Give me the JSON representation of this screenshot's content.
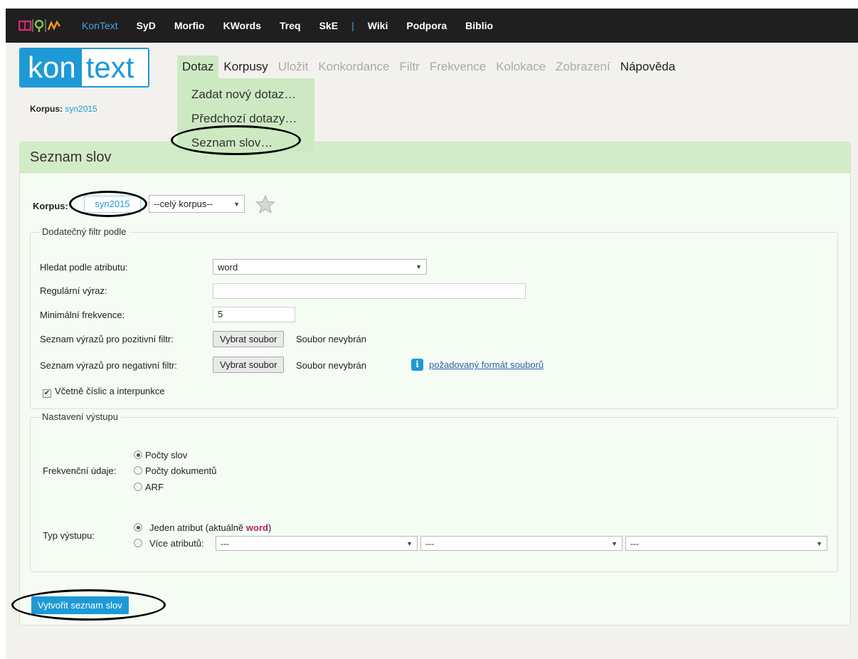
{
  "topnav": {
    "items": [
      "KonText",
      "SyD",
      "Morfio",
      "KWords",
      "Treq",
      "SkE",
      "|",
      "Wiki",
      "Podpora",
      "Biblio"
    ],
    "brand_colors": [
      "#d4286a",
      "#8bc34a",
      "#f7941d"
    ]
  },
  "brand": {
    "kon": "kon",
    "text": "text"
  },
  "corpus_line": {
    "label": "Korpus:",
    "value": "syn2015"
  },
  "mainmenu": {
    "items": [
      "Dotaz",
      "Korpusy",
      "Uložit",
      "Konkordance",
      "Filtr",
      "Frekvence",
      "Kolokace",
      "Zobrazení",
      "Nápověda"
    ]
  },
  "dropdown": {
    "items": [
      "Zadat nový dotaz…",
      "Předchozí dotazy…",
      "Seznam slov…"
    ]
  },
  "panel": {
    "title": "Seznam slov",
    "korpus_label": "Korpus:",
    "korpus_value": "syn2015",
    "subcorpus_select": "--celý korpus--",
    "filter_legend": "Dodatečný filtr podle",
    "attr_label": "Hledat podle atributu:",
    "attr_value": "word",
    "regex_label": "Regulární výraz:",
    "regex_value": "",
    "minfreq_label": "Minimální frekvence:",
    "minfreq_value": "5",
    "pos_filter_label": "Seznam výrazů pro pozitivní filtr:",
    "neg_filter_label": "Seznam výrazů pro negativní filtr:",
    "choose_file": "Vybrat soubor",
    "no_file": "Soubor nevybrán",
    "format_link": "požadovaný formát souborů",
    "include_label": "Včetně číslic a interpunkce",
    "include_checked": true,
    "output_legend": "Nastavení výstupu",
    "freq_label": "Frekvenční údaje:",
    "freq_options": [
      "Počty slov",
      "Počty dokumentů",
      "ARF"
    ],
    "freq_selected": 0,
    "type_label": "Typ výstupu:",
    "type_single": "Jeden atribut (aktuálně",
    "type_single_attr": "word",
    "type_single_end": ")",
    "type_multi": "Více atributů:",
    "multi_selects": [
      "---",
      "---",
      "---"
    ],
    "type_selected": 0,
    "submit": "Vytvořit seznam slov"
  }
}
